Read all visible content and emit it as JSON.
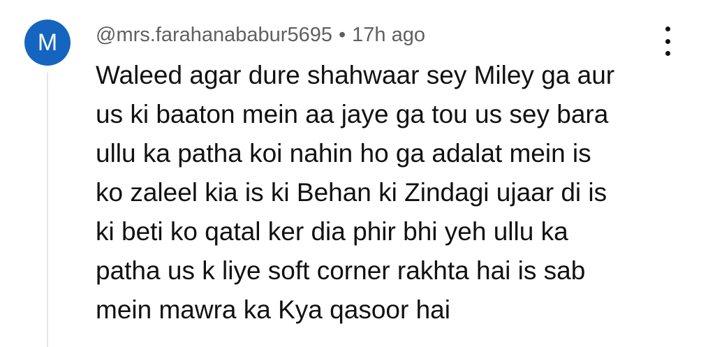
{
  "comment": {
    "avatar_letter": "M",
    "avatar_color": "#1565c0",
    "author": "@mrs.farahanababur5695",
    "separator": "•",
    "timestamp": "17h ago",
    "more_menu_icon": "vertical-ellipsis-icon",
    "text_lines": [
      "Waleed agar dure shahwaar sey Miley ga aur",
      "us ki baaton mein aa jaye ga tou us sey bara",
      "ullu ka patha koi nahin ho ga adalat mein is",
      "ko zaleel kia is ki Behan ki Zindagi ujaar di is",
      "ki beti ko qatal ker dia phir bhi yeh ullu ka",
      "patha us k liye soft corner rakhta hai is sab",
      "mein mawra ka Kya qasoor hai"
    ]
  }
}
